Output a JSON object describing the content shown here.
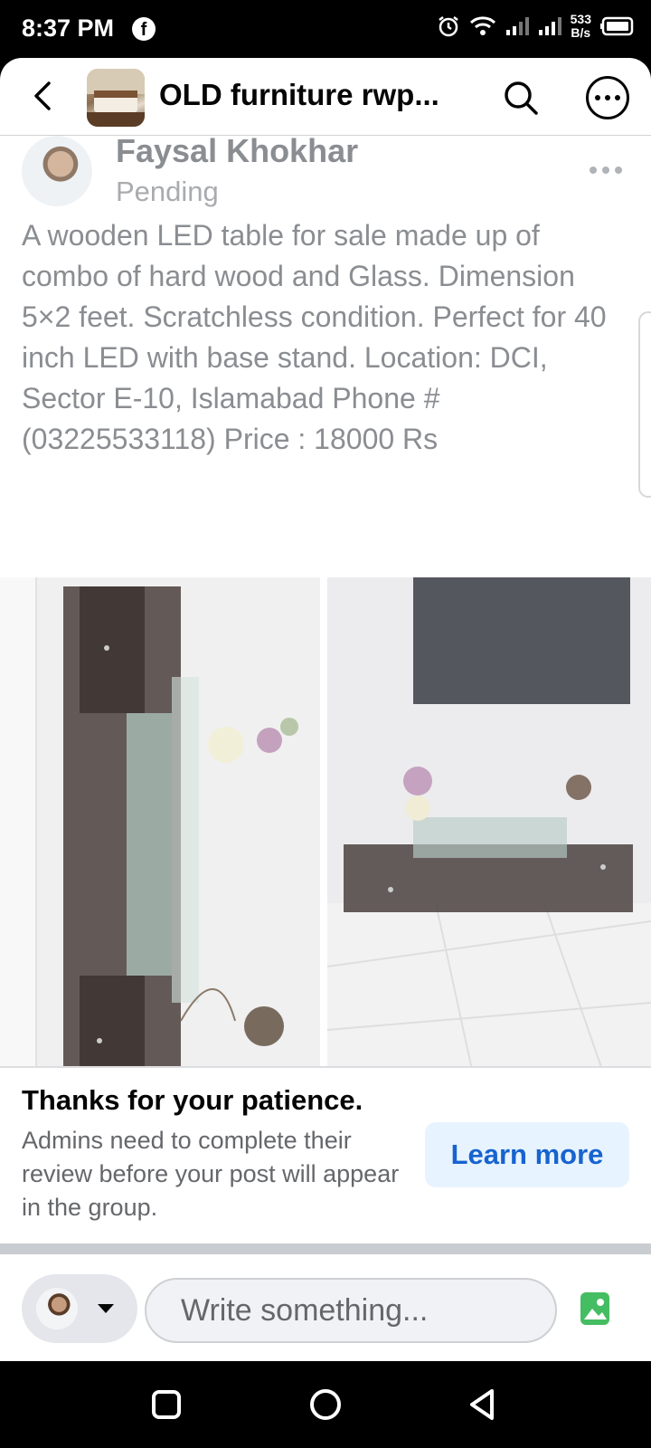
{
  "status_bar": {
    "time": "8:37 PM",
    "fb_icon": "facebook-icon",
    "net_speed_value": "533",
    "net_speed_unit": "B/s",
    "icons": [
      "alarm-icon",
      "wifi-icon",
      "signal-icon",
      "signal-icon",
      "battery-icon"
    ]
  },
  "header": {
    "back_icon": "back-arrow-icon",
    "group_title": "OLD furniture rwp...",
    "search_icon": "search-icon",
    "more_icon": "more-options-icon"
  },
  "post": {
    "author": "Faysal Khokhar",
    "status": "Pending",
    "text": "A wooden LED table for sale made up of combo of hard wood and Glass. Dimension 5×2 feet. Scratchless condition. Perfect for 40 inch LED with base stand. Location: DCI, Sector E-10, Islamabad Phone # (03225533118) Price : 18000 Rs",
    "menu_icon": "ellipsis-icon",
    "photos": [
      "tv-table-photo-1",
      "tv-table-photo-2"
    ]
  },
  "notice": {
    "title": "Thanks for your patience.",
    "body": "Admins need to complete their review before your post will appear in the group.",
    "button": "Learn more"
  },
  "composer": {
    "placeholder": "Write something...",
    "photo_icon": "photo-icon"
  },
  "nav": {
    "icons": [
      "recent-apps-icon",
      "home-icon",
      "back-icon"
    ]
  },
  "colors": {
    "accent": "#1763cf",
    "accent_bg": "#e7f3ff",
    "photo_green": "#45bd62"
  }
}
